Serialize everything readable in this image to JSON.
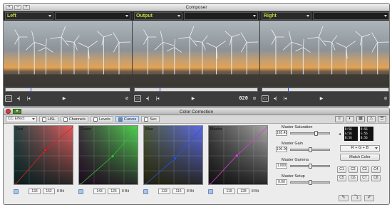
{
  "composer": {
    "title": "Composer",
    "monitors": [
      {
        "label": "Left",
        "timecode": ""
      },
      {
        "label": "Output",
        "timecode": "020"
      },
      {
        "label": "Right",
        "timecode": ""
      }
    ]
  },
  "cc": {
    "title": "Color Correction",
    "effect_select": "CC Effect",
    "tabs": [
      "HSL",
      "Channels",
      "Levels",
      "Curves",
      "Sec"
    ],
    "active_tab": "Curves",
    "curves": [
      {
        "label": "Red",
        "in": "133",
        "out": "152",
        "bit": "8 Bit",
        "accent": "#e02020"
      },
      {
        "label": "Green",
        "in": "143",
        "out": "126",
        "bit": "8 Bit",
        "accent": "#30c030"
      },
      {
        "label": "Blue",
        "in": "133",
        "out": "116",
        "bit": "8 Bit",
        "accent": "#3050e0"
      },
      {
        "label": "Master",
        "in": "119",
        "out": "128",
        "bit": "8 Bit",
        "accent": "#d040d0"
      }
    ],
    "sliders": [
      {
        "label": "Master Saturation",
        "value": "165.43",
        "level": 0.65
      },
      {
        "label": "Master Gain",
        "value": "100.00",
        "level": 0.5
      },
      {
        "label": "Master Gamma",
        "value": "1.000",
        "level": 0.5
      },
      {
        "label": "Master Setup",
        "value": "0.00",
        "level": 0.5
      }
    ],
    "rgb_left": [
      "R:56",
      "G:56",
      "B:56"
    ],
    "rgb_right": [
      "R:56",
      "G:56",
      "B:56"
    ],
    "formula": "R + G + B",
    "match_button": "Match Color",
    "c_buttons": [
      "C1",
      "C2",
      "C3",
      "C4",
      "C5",
      "C6",
      "C7",
      "C8"
    ]
  }
}
